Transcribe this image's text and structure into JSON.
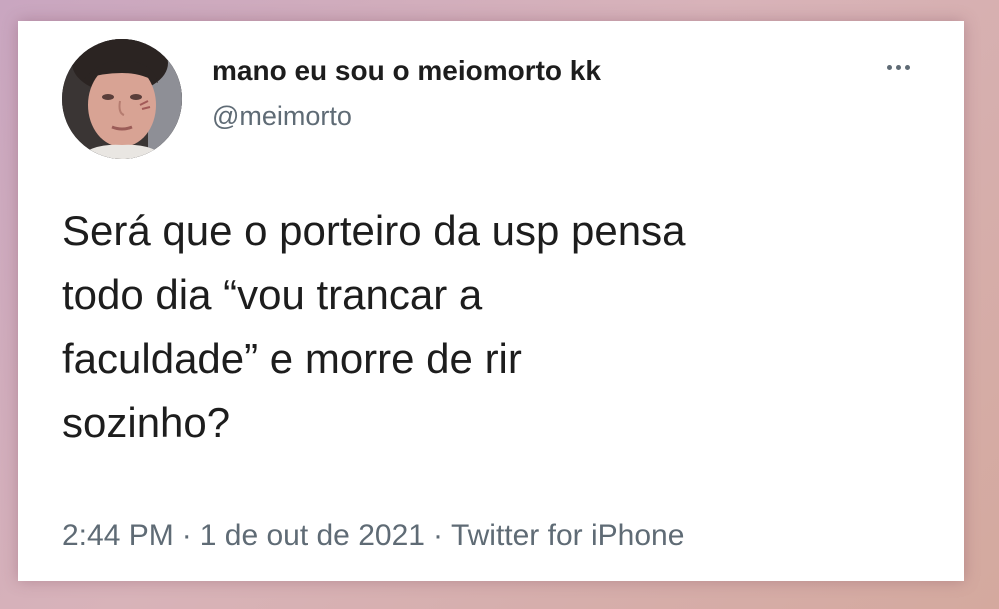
{
  "tweet": {
    "display_name": "mano eu sou o meiomorto kk",
    "handle": "@meimorto",
    "text_lines": [
      "Será que o porteiro da usp pensa",
      "todo dia “vou trancar a",
      "faculdade” e morre de rir",
      "sozinho?"
    ],
    "time": "2:44 PM",
    "date": "1 de out de 2021",
    "source": "Twitter for iPhone",
    "separator": "·",
    "more_icon": "more-options-icon"
  },
  "colors": {
    "card_background": "#ffffff",
    "text_primary": "#1d1d1d",
    "text_secondary": "#5f6b75",
    "frame_background": "#d4adb8"
  }
}
